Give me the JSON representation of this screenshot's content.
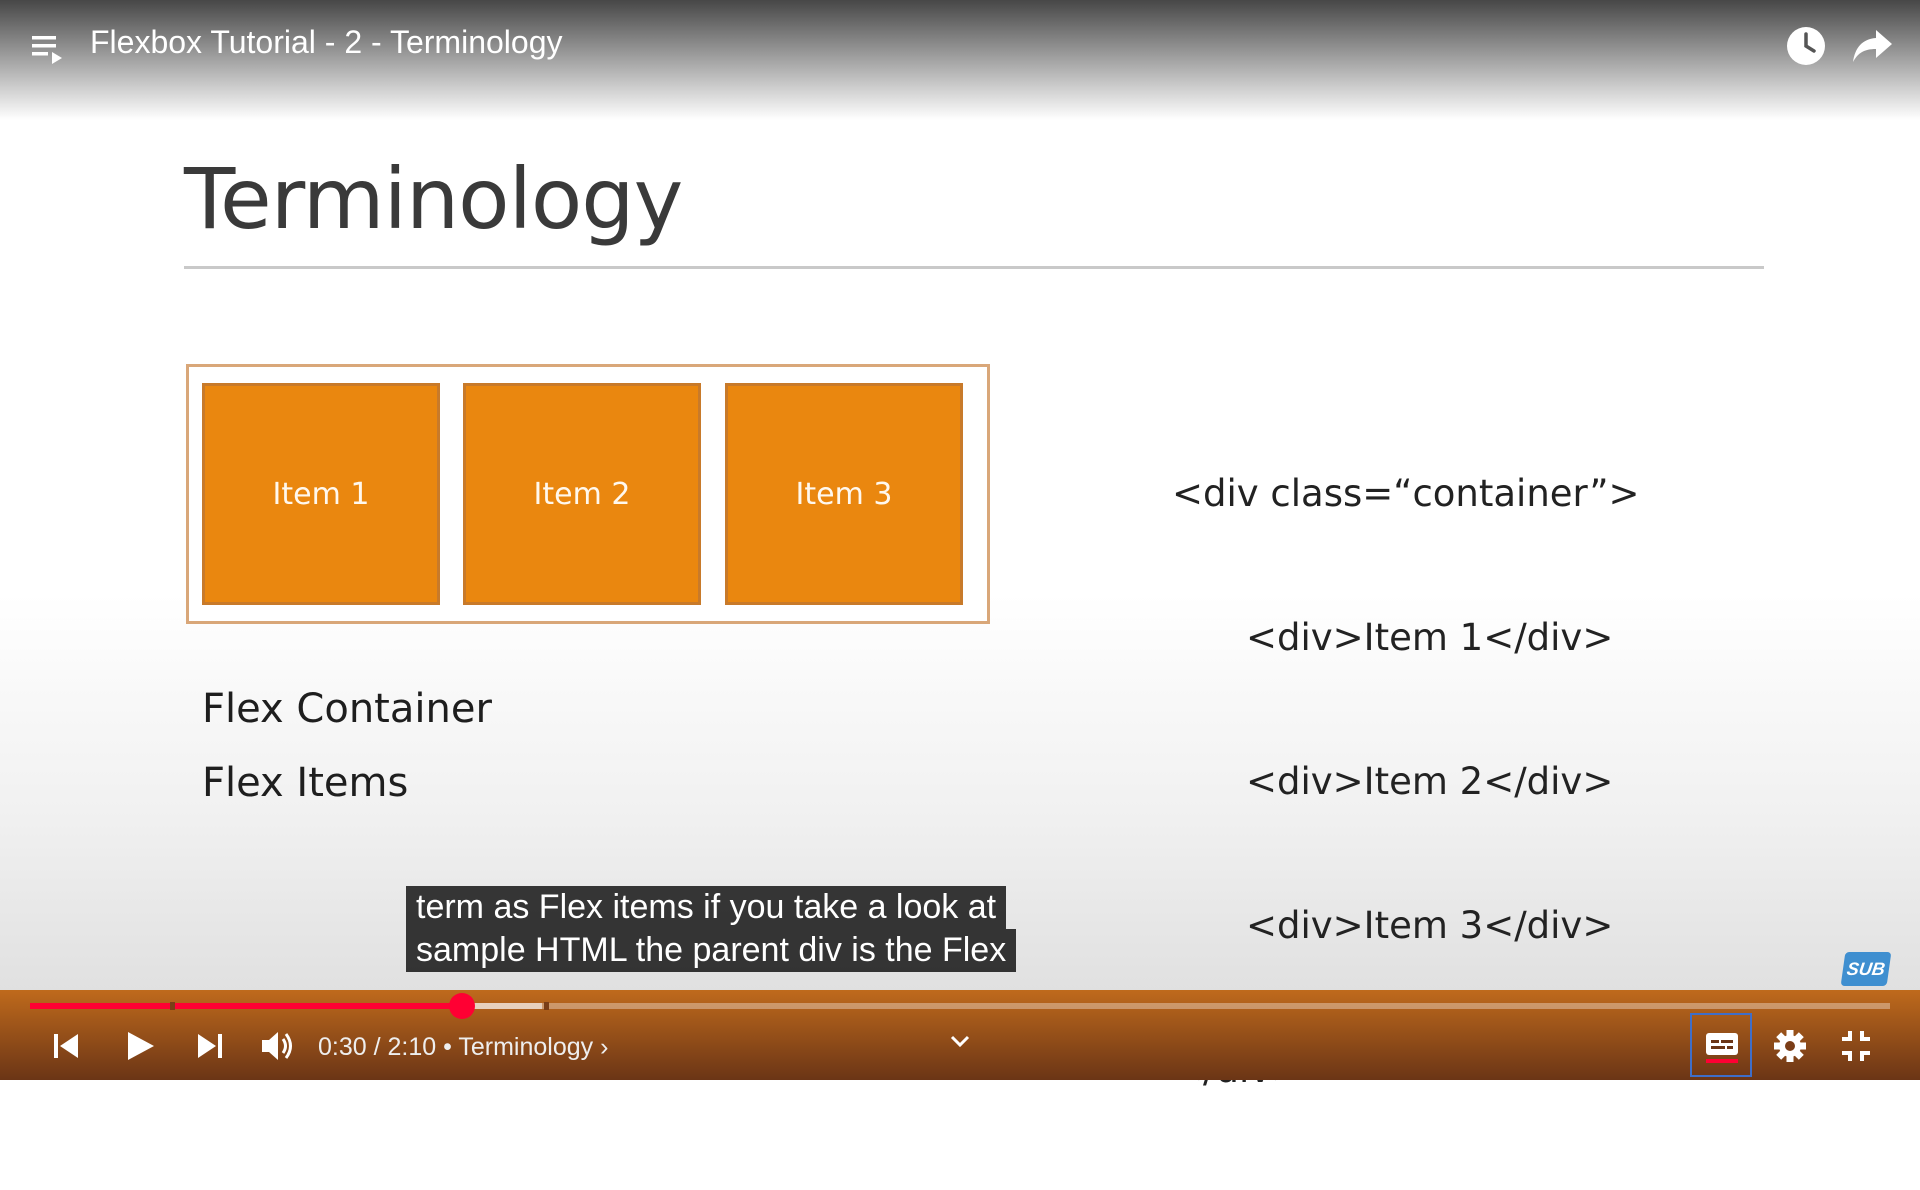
{
  "player": {
    "title": "Flexbox Tutorial - 2 - Terminology",
    "time_display": "0:30 / 2:10",
    "chapter_separator": "•",
    "chapter": "Terminology",
    "chapter_arrow": "›",
    "progress_played": 0.232,
    "progress_buffered": 0.275,
    "colors": {
      "accent": "#ff0033",
      "controls_bg": "#8a4418"
    }
  },
  "slide": {
    "title": "Terminology",
    "items": [
      "Item 1",
      "Item 2",
      "Item 3"
    ],
    "code_lines": [
      "<div class=“container”>",
      "<div>Item 1</div>",
      "<div>Item 2</div>",
      "<div>Item 3</div>",
      "</div>"
    ],
    "terms": [
      "Flex Container",
      "Flex Items"
    ],
    "colors": {
      "item_fill": "#ea870f",
      "container_border": "#d9a779"
    }
  },
  "captions": {
    "line1": "term as Flex items if you take a look at",
    "line2": "sample HTML the parent div is the Flex"
  },
  "watermark": {
    "label": "SUB"
  },
  "icons": {
    "playlist": "playlist-icon",
    "watch_later": "clock-icon",
    "share": "share-icon",
    "previous": "skip-previous-icon",
    "play": "play-icon",
    "next": "skip-next-icon",
    "volume": "volume-icon",
    "chapters": "chevron-down-icon",
    "subtitles": "subtitles-icon",
    "settings": "gear-icon",
    "exit_fullscreen": "exit-fullscreen-icon"
  }
}
